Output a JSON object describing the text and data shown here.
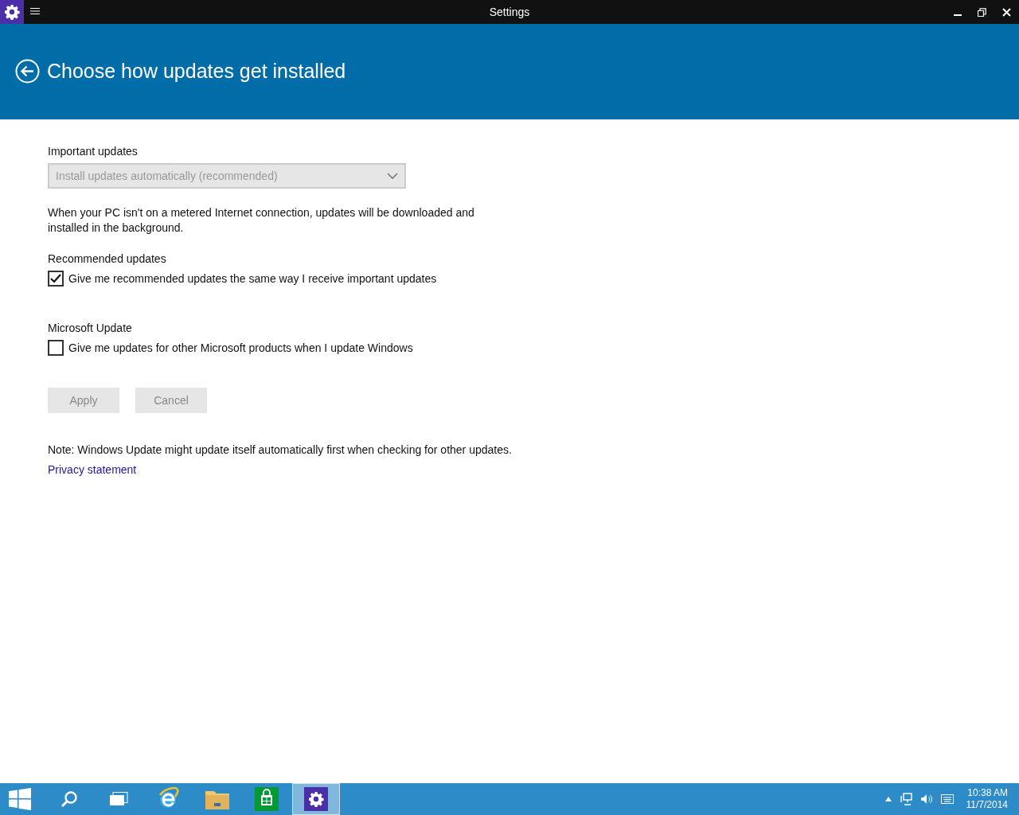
{
  "window": {
    "title": "Settings"
  },
  "header": {
    "title": "Choose how updates get installed"
  },
  "important_updates": {
    "label": "Important updates",
    "dropdown": {
      "value": "Install updates automatically (recommended)",
      "disabled": true
    },
    "description": "When your PC isn't on a metered Internet connection, updates will be downloaded and installed in the background."
  },
  "options": [
    {
      "heading": "Recommended updates",
      "label": "Give me recommended updates the same way I receive important updates",
      "checked": true
    },
    {
      "heading": "Microsoft Update",
      "label": "Give me updates for other Microsoft products when I update Windows",
      "checked": false
    }
  ],
  "buttons": [
    {
      "label": "Apply",
      "disabled": true
    },
    {
      "label": "Cancel",
      "disabled": true
    }
  ],
  "note": "Note: Windows Update might update itself automatically first when checking for other updates.",
  "link": "Privacy statement",
  "taskbar": {
    "apps": [
      {
        "kind": "start",
        "selected": false
      },
      {
        "kind": "search",
        "selected": false
      },
      {
        "kind": "taskview",
        "selected": false
      },
      {
        "kind": "browser",
        "selected": false
      },
      {
        "kind": "folder",
        "selected": false
      },
      {
        "kind": "store",
        "selected": false
      },
      {
        "kind": "settings",
        "selected": true
      }
    ],
    "clock": {
      "time": "10:38 AM",
      "date": "11/7/2014"
    }
  }
}
